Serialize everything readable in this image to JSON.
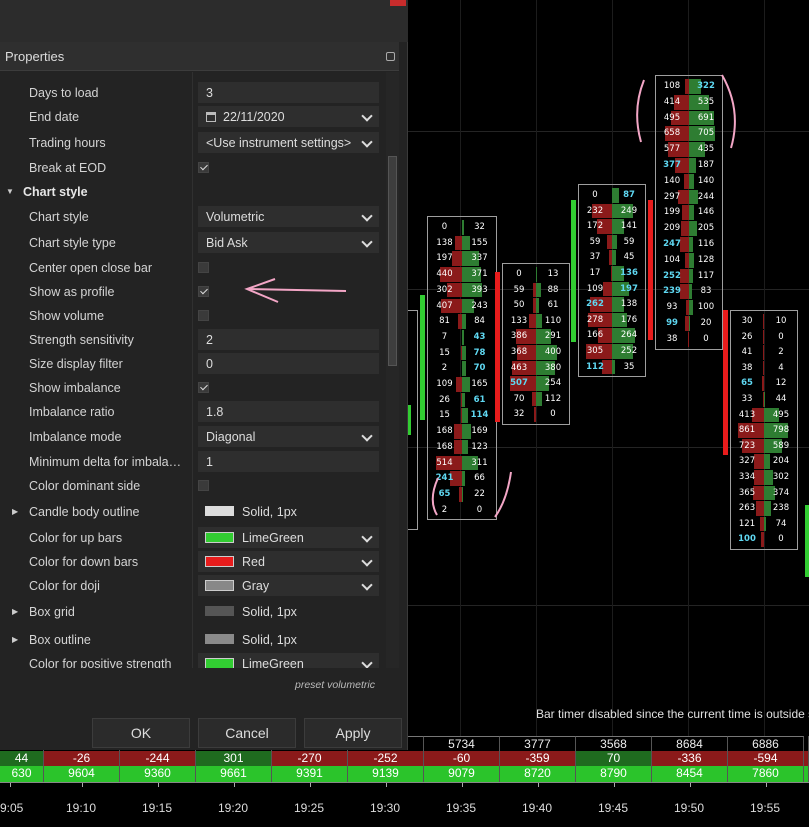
{
  "dialog": {
    "panel_title": "Properties",
    "close_icon": "close-icon",
    "rows": [
      {
        "type": "input",
        "label": "Days to load",
        "value": "3"
      },
      {
        "type": "date",
        "label": "End date",
        "value": "22/11/2020"
      },
      {
        "type": "select",
        "label": "Trading hours",
        "value": "<Use instrument settings>"
      },
      {
        "type": "check",
        "label": "Break at EOD",
        "checked": true
      },
      {
        "type": "category",
        "label": "Chart style",
        "expanded": true
      },
      {
        "type": "select",
        "label": "Chart style",
        "value": "Volumetric"
      },
      {
        "type": "select",
        "label": "Chart style type",
        "value": "Bid Ask"
      },
      {
        "type": "check",
        "label": "Center open close bar",
        "checked": false
      },
      {
        "type": "check",
        "label": "Show as profile",
        "checked": true
      },
      {
        "type": "check",
        "label": "Show volume",
        "checked": false
      },
      {
        "type": "input",
        "label": "Strength sensitivity",
        "value": "2"
      },
      {
        "type": "input",
        "label": "Size display filter",
        "value": "0"
      },
      {
        "type": "check",
        "label": "Show imbalance",
        "checked": true
      },
      {
        "type": "input",
        "label": "Imbalance ratio",
        "value": "1.8"
      },
      {
        "type": "select",
        "label": "Imbalance mode",
        "value": "Diagonal"
      },
      {
        "type": "input",
        "label": "Minimum delta for imbala…",
        "value": "1"
      },
      {
        "type": "check",
        "label": "Color dominant side",
        "checked": false
      },
      {
        "type": "stroke",
        "label": "Candle body outline",
        "value": "Solid, 1px",
        "color": "#dcdcdc"
      },
      {
        "type": "color",
        "label": "Color for up bars",
        "value": "LimeGreen",
        "color": "#32cd32"
      },
      {
        "type": "color",
        "label": "Color for down bars",
        "value": "Red",
        "color": "#e81c1c"
      },
      {
        "type": "color",
        "label": "Color for doji",
        "value": "Gray",
        "color": "#888888"
      },
      {
        "type": "stroke",
        "label": "Box grid",
        "value": "Solid, 1px",
        "color": "#555555"
      },
      {
        "type": "stroke",
        "label": "Box outline",
        "value": "Solid, 1px",
        "color": "#8a8a8a"
      },
      {
        "type": "color",
        "label": "Color for positive strength",
        "value": "LimeGreen",
        "color": "#32cd32"
      }
    ],
    "preset": "preset volumetric",
    "buttons": {
      "ok": "OK",
      "cancel": "Cancel",
      "apply": "Apply"
    }
  },
  "chart": {
    "timer_text": "Bar timer disabled since the current time is outside s",
    "time_labels": [
      "9:05",
      "19:10",
      "19:15",
      "19:20",
      "19:25",
      "19:30",
      "19:35",
      "19:40",
      "19:45",
      "19:50",
      "19:55"
    ],
    "row1": [
      "",
      "",
      "",
      "",
      "",
      "",
      "5734",
      "3777",
      "3568",
      "8684",
      "6886",
      ""
    ],
    "row2": [
      "44",
      "-26",
      "-244",
      "301",
      "-270",
      "-252",
      "-60",
      "-359",
      "70",
      "-336",
      "-594",
      ""
    ],
    "row3": [
      "630",
      "9604",
      "9360",
      "9661",
      "9391",
      "9139",
      "9079",
      "8720",
      "8790",
      "8454",
      "7860",
      ""
    ],
    "footprints": [
      {
        "name": "bar-1935",
        "rows": [
          [
            "0",
            "32"
          ],
          [
            "138",
            "155"
          ],
          [
            "197",
            "337"
          ],
          [
            "440",
            "371"
          ],
          [
            "302",
            "393"
          ],
          [
            "407",
            "243"
          ],
          [
            "81",
            "84"
          ],
          [
            "7",
            "43"
          ],
          [
            "15",
            "78"
          ],
          [
            "2",
            "70"
          ],
          [
            "109",
            "165"
          ],
          [
            "26",
            "61"
          ],
          [
            "15",
            "114"
          ],
          [
            "168",
            "169"
          ],
          [
            "168",
            "123"
          ],
          [
            "514",
            "311"
          ],
          [
            "241",
            "66"
          ],
          [
            "65",
            "22"
          ],
          [
            "2",
            "0"
          ]
        ]
      },
      {
        "name": "bar-1940",
        "rows": [
          [
            "0",
            "13"
          ],
          [
            "59",
            "88"
          ],
          [
            "50",
            "61"
          ],
          [
            "133",
            "110"
          ],
          [
            "386",
            "291"
          ],
          [
            "368",
            "400"
          ],
          [
            "463",
            "380"
          ],
          [
            "507",
            "254"
          ],
          [
            "70",
            "112"
          ],
          [
            "32",
            "0"
          ]
        ]
      },
      {
        "name": "bar-1945",
        "rows": [
          [
            "0",
            "87"
          ],
          [
            "232",
            "249"
          ],
          [
            "172",
            "141"
          ],
          [
            "59",
            "59"
          ],
          [
            "37",
            "45"
          ],
          [
            "17",
            "136"
          ],
          [
            "109",
            "197"
          ],
          [
            "262",
            "138"
          ],
          [
            "278",
            "176"
          ],
          [
            "166",
            "264"
          ],
          [
            "305",
            "252"
          ],
          [
            "112",
            "35"
          ]
        ]
      },
      {
        "name": "bar-1950",
        "rows": [
          [
            "108",
            "322"
          ],
          [
            "414",
            "535"
          ],
          [
            "495",
            "691"
          ],
          [
            "658",
            "705"
          ],
          [
            "577",
            "435"
          ],
          [
            "377",
            "187"
          ],
          [
            "140",
            "140"
          ],
          [
            "297",
            "244"
          ],
          [
            "199",
            "146"
          ],
          [
            "209",
            "205"
          ],
          [
            "247",
            "116"
          ],
          [
            "104",
            "128"
          ],
          [
            "252",
            "117"
          ],
          [
            "239",
            "83"
          ],
          [
            "93",
            "100"
          ],
          [
            "99",
            "20"
          ],
          [
            "38",
            "0"
          ]
        ]
      },
      {
        "name": "bar-1955",
        "rows": [
          [
            "30",
            "10"
          ],
          [
            "26",
            "0"
          ],
          [
            "41",
            "2"
          ],
          [
            "38",
            "4"
          ],
          [
            "65",
            "12"
          ],
          [
            "33",
            "44"
          ],
          [
            "413",
            "495"
          ],
          [
            "861",
            "798"
          ],
          [
            "723",
            "589"
          ],
          [
            "327",
            "204"
          ],
          [
            "334",
            "302"
          ],
          [
            "365",
            "374"
          ],
          [
            "263",
            "238"
          ],
          [
            "121",
            "74"
          ],
          [
            "100",
            "0"
          ]
        ]
      }
    ]
  }
}
